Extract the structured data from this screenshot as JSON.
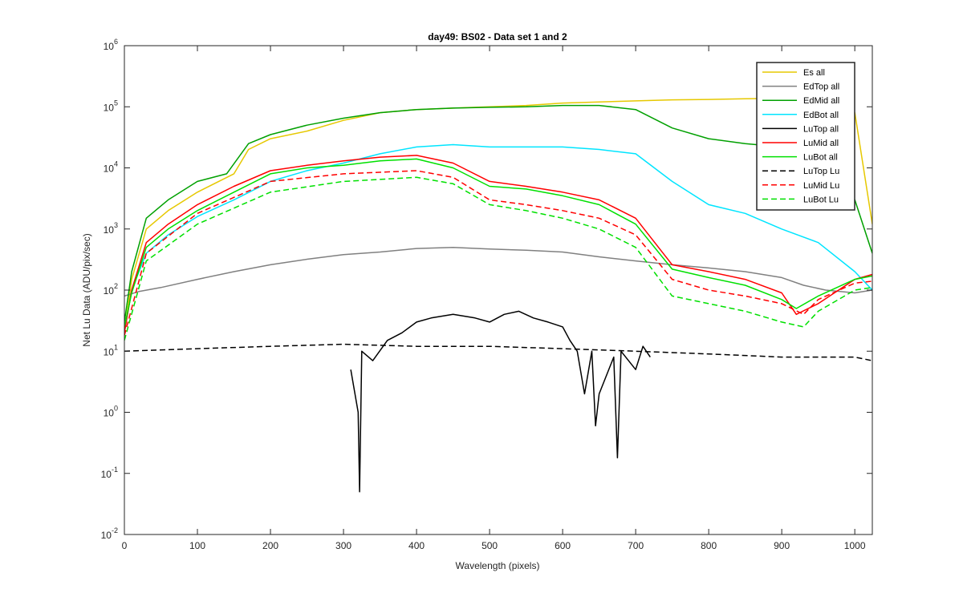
{
  "chart_data": {
    "type": "line",
    "title": "day49: BS02 - Data set 1 and 2",
    "xlabel": "Wavelength (pixels)",
    "ylabel": "Net Lu Data (ADU/pix/sec)",
    "xlim": [
      0,
      1024
    ],
    "ylim": [
      0.01,
      1000000
    ],
    "yscale": "log",
    "grid": false,
    "legend_position": "top-right",
    "x_ticks": [
      {
        "value": 0,
        "label": "0"
      },
      {
        "value": 100,
        "label": "100"
      },
      {
        "value": 200,
        "label": "200"
      },
      {
        "value": 300,
        "label": "300"
      },
      {
        "value": 400,
        "label": "400"
      },
      {
        "value": 500,
        "label": "500"
      },
      {
        "value": 600,
        "label": "600"
      },
      {
        "value": 700,
        "label": "700"
      },
      {
        "value": 800,
        "label": "800"
      },
      {
        "value": 900,
        "label": "900"
      },
      {
        "value": 1000,
        "label": "1000"
      }
    ],
    "y_ticks": [
      {
        "value": 0.01,
        "base": "10",
        "exp": "-2"
      },
      {
        "value": 0.1,
        "base": "10",
        "exp": "-1"
      },
      {
        "value": 1,
        "base": "10",
        "exp": "0"
      },
      {
        "value": 10,
        "base": "10",
        "exp": "1"
      },
      {
        "value": 100,
        "base": "10",
        "exp": "2"
      },
      {
        "value": 1000,
        "base": "10",
        "exp": "3"
      },
      {
        "value": 10000,
        "base": "10",
        "exp": "4"
      },
      {
        "value": 100000,
        "base": "10",
        "exp": "5"
      },
      {
        "value": 1000000,
        "base": "10",
        "exp": "6"
      }
    ],
    "series": [
      {
        "name": "Es  all",
        "color": "#E6C800",
        "dash": "solid",
        "points": [
          [
            0,
            20
          ],
          [
            10,
            150
          ],
          [
            30,
            1000
          ],
          [
            60,
            2000
          ],
          [
            100,
            4000
          ],
          [
            150,
            8000
          ],
          [
            170,
            20000
          ],
          [
            200,
            30000
          ],
          [
            250,
            40000
          ],
          [
            300,
            60000
          ],
          [
            350,
            80000
          ],
          [
            400,
            90000
          ],
          [
            450,
            95000
          ],
          [
            500,
            100000
          ],
          [
            550,
            105000
          ],
          [
            600,
            115000
          ],
          [
            650,
            120000
          ],
          [
            700,
            125000
          ],
          [
            750,
            130000
          ],
          [
            800,
            132000
          ],
          [
            850,
            135000
          ],
          [
            900,
            138000
          ],
          [
            950,
            140000
          ],
          [
            1000,
            80000
          ],
          [
            1024,
            1200
          ]
        ]
      },
      {
        "name": "EdTop  all",
        "color": "#808080",
        "dash": "solid",
        "points": [
          [
            0,
            80
          ],
          [
            20,
            95
          ],
          [
            50,
            110
          ],
          [
            100,
            150
          ],
          [
            150,
            200
          ],
          [
            200,
            260
          ],
          [
            250,
            320
          ],
          [
            300,
            380
          ],
          [
            350,
            420
          ],
          [
            400,
            480
          ],
          [
            450,
            500
          ],
          [
            500,
            470
          ],
          [
            550,
            450
          ],
          [
            600,
            420
          ],
          [
            650,
            350
          ],
          [
            700,
            300
          ],
          [
            750,
            260
          ],
          [
            800,
            230
          ],
          [
            850,
            200
          ],
          [
            900,
            160
          ],
          [
            930,
            120
          ],
          [
            960,
            100
          ],
          [
            1000,
            90
          ],
          [
            1024,
            100
          ]
        ]
      },
      {
        "name": "EdMid  all",
        "color": "#00A000",
        "dash": "solid",
        "points": [
          [
            0,
            30
          ],
          [
            10,
            200
          ],
          [
            30,
            1500
          ],
          [
            60,
            3000
          ],
          [
            100,
            6000
          ],
          [
            140,
            8000
          ],
          [
            170,
            25000
          ],
          [
            200,
            35000
          ],
          [
            250,
            50000
          ],
          [
            300,
            65000
          ],
          [
            350,
            80000
          ],
          [
            400,
            90000
          ],
          [
            450,
            95000
          ],
          [
            500,
            98000
          ],
          [
            550,
            100000
          ],
          [
            600,
            105000
          ],
          [
            650,
            105000
          ],
          [
            700,
            90000
          ],
          [
            750,
            45000
          ],
          [
            800,
            30000
          ],
          [
            850,
            25000
          ],
          [
            900,
            22000
          ],
          [
            950,
            18000
          ],
          [
            980,
            10000
          ],
          [
            1000,
            3000
          ],
          [
            1024,
            400
          ]
        ]
      },
      {
        "name": "EdBot  all",
        "color": "#00E5FF",
        "dash": "solid",
        "points": [
          [
            0,
            20
          ],
          [
            10,
            100
          ],
          [
            30,
            400
          ],
          [
            60,
            800
          ],
          [
            100,
            1600
          ],
          [
            150,
            3000
          ],
          [
            200,
            6000
          ],
          [
            250,
            9000
          ],
          [
            300,
            12000
          ],
          [
            350,
            17000
          ],
          [
            400,
            22000
          ],
          [
            450,
            24000
          ],
          [
            500,
            22000
          ],
          [
            550,
            22000
          ],
          [
            600,
            22000
          ],
          [
            650,
            20000
          ],
          [
            700,
            17000
          ],
          [
            750,
            6000
          ],
          [
            800,
            2500
          ],
          [
            850,
            1800
          ],
          [
            900,
            1000
          ],
          [
            950,
            600
          ],
          [
            1000,
            200
          ],
          [
            1024,
            100
          ]
        ]
      },
      {
        "name": "LuTop  all",
        "color": "#000000",
        "dash": "solid",
        "points": [
          [
            310,
            5
          ],
          [
            320,
            1
          ],
          [
            322,
            0.05
          ],
          [
            325,
            10
          ],
          [
            340,
            7
          ],
          [
            360,
            15
          ],
          [
            380,
            20
          ],
          [
            400,
            30
          ],
          [
            420,
            35
          ],
          [
            450,
            40
          ],
          [
            480,
            35
          ],
          [
            500,
            30
          ],
          [
            520,
            40
          ],
          [
            540,
            45
          ],
          [
            560,
            35
          ],
          [
            580,
            30
          ],
          [
            600,
            25
          ],
          [
            610,
            15
          ],
          [
            620,
            10
          ],
          [
            630,
            2
          ],
          [
            640,
            10
          ],
          [
            645,
            0.6
          ],
          [
            650,
            2
          ],
          [
            670,
            8
          ],
          [
            675,
            0.18
          ],
          [
            680,
            10
          ],
          [
            700,
            5
          ],
          [
            710,
            12
          ],
          [
            720,
            8
          ]
        ]
      },
      {
        "name": "LuMid  all",
        "color": "#FF0000",
        "dash": "solid",
        "points": [
          [
            0,
            20
          ],
          [
            10,
            100
          ],
          [
            30,
            600
          ],
          [
            60,
            1200
          ],
          [
            100,
            2500
          ],
          [
            150,
            5000
          ],
          [
            200,
            9000
          ],
          [
            250,
            11000
          ],
          [
            300,
            13000
          ],
          [
            350,
            15000
          ],
          [
            400,
            16000
          ],
          [
            450,
            12000
          ],
          [
            500,
            6000
          ],
          [
            550,
            5000
          ],
          [
            600,
            4000
          ],
          [
            650,
            3000
          ],
          [
            700,
            1500
          ],
          [
            750,
            260
          ],
          [
            800,
            200
          ],
          [
            850,
            150
          ],
          [
            900,
            90
          ],
          [
            920,
            40
          ],
          [
            950,
            60
          ],
          [
            1000,
            150
          ],
          [
            1024,
            180
          ]
        ]
      },
      {
        "name": "LuBot  all",
        "color": "#00E000",
        "dash": "solid",
        "points": [
          [
            0,
            25
          ],
          [
            10,
            90
          ],
          [
            30,
            500
          ],
          [
            60,
            1000
          ],
          [
            100,
            2000
          ],
          [
            150,
            4000
          ],
          [
            200,
            8000
          ],
          [
            250,
            10000
          ],
          [
            300,
            11000
          ],
          [
            350,
            13000
          ],
          [
            400,
            14000
          ],
          [
            450,
            10000
          ],
          [
            500,
            5000
          ],
          [
            550,
            4500
          ],
          [
            600,
            3500
          ],
          [
            650,
            2500
          ],
          [
            700,
            1200
          ],
          [
            750,
            220
          ],
          [
            800,
            160
          ],
          [
            850,
            120
          ],
          [
            900,
            70
          ],
          [
            920,
            50
          ],
          [
            950,
            80
          ],
          [
            1000,
            150
          ],
          [
            1024,
            170
          ]
        ]
      },
      {
        "name": "LuTop  Lu",
        "color": "#000000",
        "dash": "dashed",
        "points": [
          [
            0,
            10
          ],
          [
            100,
            11
          ],
          [
            200,
            12
          ],
          [
            300,
            13
          ],
          [
            400,
            12
          ],
          [
            500,
            12
          ],
          [
            600,
            11
          ],
          [
            700,
            10
          ],
          [
            800,
            9
          ],
          [
            900,
            8
          ],
          [
            1000,
            8
          ],
          [
            1024,
            7
          ]
        ]
      },
      {
        "name": "LuMid  Lu",
        "color": "#FF0000",
        "dash": "dashed",
        "points": [
          [
            0,
            18
          ],
          [
            30,
            400
          ],
          [
            100,
            1800
          ],
          [
            200,
            6000
          ],
          [
            300,
            8000
          ],
          [
            400,
            9000
          ],
          [
            450,
            7000
          ],
          [
            500,
            3000
          ],
          [
            550,
            2500
          ],
          [
            600,
            2000
          ],
          [
            650,
            1500
          ],
          [
            700,
            800
          ],
          [
            750,
            150
          ],
          [
            800,
            100
          ],
          [
            850,
            80
          ],
          [
            900,
            60
          ],
          [
            930,
            40
          ],
          [
            950,
            70
          ],
          [
            1000,
            130
          ],
          [
            1024,
            140
          ]
        ]
      },
      {
        "name": "LuBot  Lu",
        "color": "#00E000",
        "dash": "dashed",
        "points": [
          [
            0,
            15
          ],
          [
            30,
            300
          ],
          [
            100,
            1200
          ],
          [
            200,
            4000
          ],
          [
            300,
            6000
          ],
          [
            400,
            7000
          ],
          [
            450,
            5500
          ],
          [
            500,
            2500
          ],
          [
            550,
            2000
          ],
          [
            600,
            1500
          ],
          [
            650,
            1000
          ],
          [
            700,
            500
          ],
          [
            750,
            80
          ],
          [
            800,
            60
          ],
          [
            850,
            45
          ],
          [
            900,
            30
          ],
          [
            930,
            25
          ],
          [
            950,
            45
          ],
          [
            1000,
            100
          ],
          [
            1024,
            110
          ]
        ]
      }
    ]
  }
}
